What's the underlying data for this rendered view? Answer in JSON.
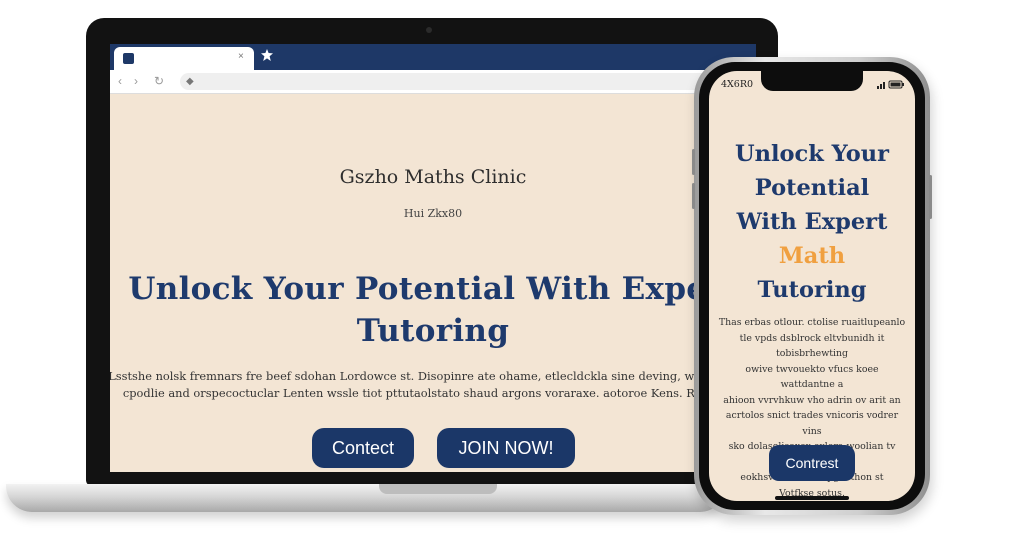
{
  "laptop": {
    "browser": {
      "tab_close_glyph": "×",
      "back_glyph": "‹",
      "forward_glyph": "›",
      "reload_glyph": "↻",
      "lock_glyph": "🔒"
    },
    "page": {
      "brand_name": "Gszho Maths Clinic",
      "tagline": "Hui Zkx80",
      "hero_title_line1": "Unlock Your Potential With Expert",
      "hero_title_line2": "Tutoring",
      "description_line1": "Lsstshe nolsk fremnars fre beef sdohan Lordowce st. Disopinre ate ohame, etlecldckla sine deving, wrastulturse",
      "description_line2": "cpodlie and orspecoctuclar Lenten wssle tiot pttutaolstato shaud argons voraraxe. aotoroe Kens. Rukahuse",
      "contact_button": "Contect",
      "join_button": "JOIN NOW!"
    }
  },
  "phone": {
    "status_time": "4X6R0",
    "title_line1": "Unlock Your",
    "title_line2": "Potential",
    "title_line3": "With Expert",
    "title_line4_accent": "Math",
    "title_line5": "Tutoring",
    "description_lines": [
      "Thas erbas otlour. ctolise ruaitlupeanlo",
      "tle vpds dsblrock eltvbunidh it tobisbrhewting",
      "owive twvouekto vfucs koee wattdantne a",
      "ahioon vvrvhkuw vho adrin ov arit an",
      "acrtolos snict trades vnicoris vodrer vins",
      "sko dolasolisoxex exlora woolian tv odicve",
      "eokhsve covr vise pgoothon st",
      "Votfkse sotus."
    ],
    "contact_button": "Contrest"
  },
  "colors": {
    "navy": "#1e3a6d",
    "button_navy": "#1b3768",
    "accent_orange": "#f0a040",
    "page_cream": "#f3e5d4"
  },
  "icons": [
    "favicon-icon",
    "tab-close-icon",
    "new-tab-icon",
    "back-icon",
    "forward-icon",
    "reload-icon",
    "lock-icon",
    "signal-battery-icon"
  ]
}
